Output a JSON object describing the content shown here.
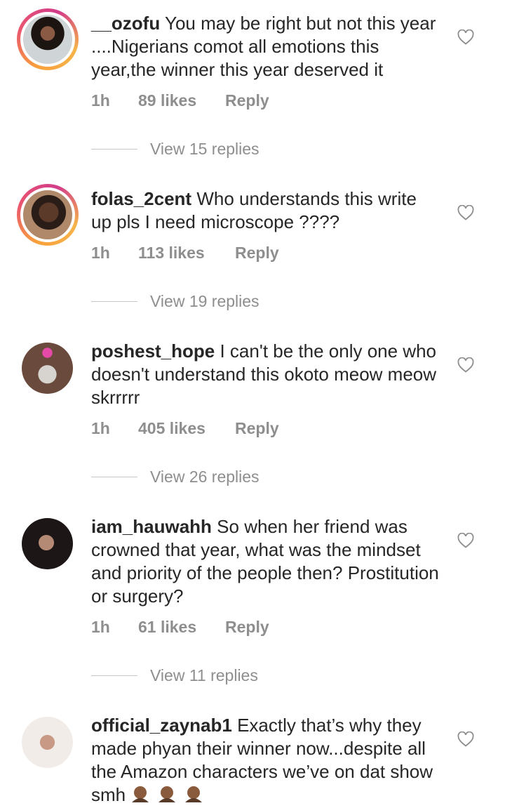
{
  "comments": [
    {
      "username": "__ozofu",
      "text": "You may be right but not this year ....Nigerians comot all emotions this year,the winner this year deserved it",
      "time": "1h",
      "likes": "89 likes",
      "reply": "Reply",
      "view_replies": "View 15 replies",
      "avatar_story": true
    },
    {
      "username": "folas_2cent",
      "text": "Who understands this write up pls I need microscope ????",
      "time": "1h",
      "likes": "113 likes",
      "reply": "Reply",
      "view_replies": "View 19 replies",
      "avatar_story": true
    },
    {
      "username": "poshest_hope",
      "text": "I can't be the only one who doesn't understand this okoto meow meow skrrrrr",
      "time": "1h",
      "likes": "405 likes",
      "reply": "Reply",
      "view_replies": "View 26 replies",
      "avatar_story": false
    },
    {
      "username": "iam_hauwahh",
      "text": "So when her friend was crowned that year, what was the mindset and priority of the people then? Prostitution or surgery?",
      "time": "1h",
      "likes": "61 likes",
      "reply": "Reply",
      "view_replies": "View 11 replies",
      "avatar_story": false
    },
    {
      "username": "official_zaynab1",
      "text": "Exactly that’s why they made phyan their winner now...despite all the Amazon characters we’ve on dat show smh",
      "avatar_story": false
    }
  ],
  "colors": {
    "text": "#262626",
    "muted": "#8e8e8e",
    "story_ring": "#d23b8a"
  },
  "icons": {
    "like": "heart-outline-icon"
  }
}
